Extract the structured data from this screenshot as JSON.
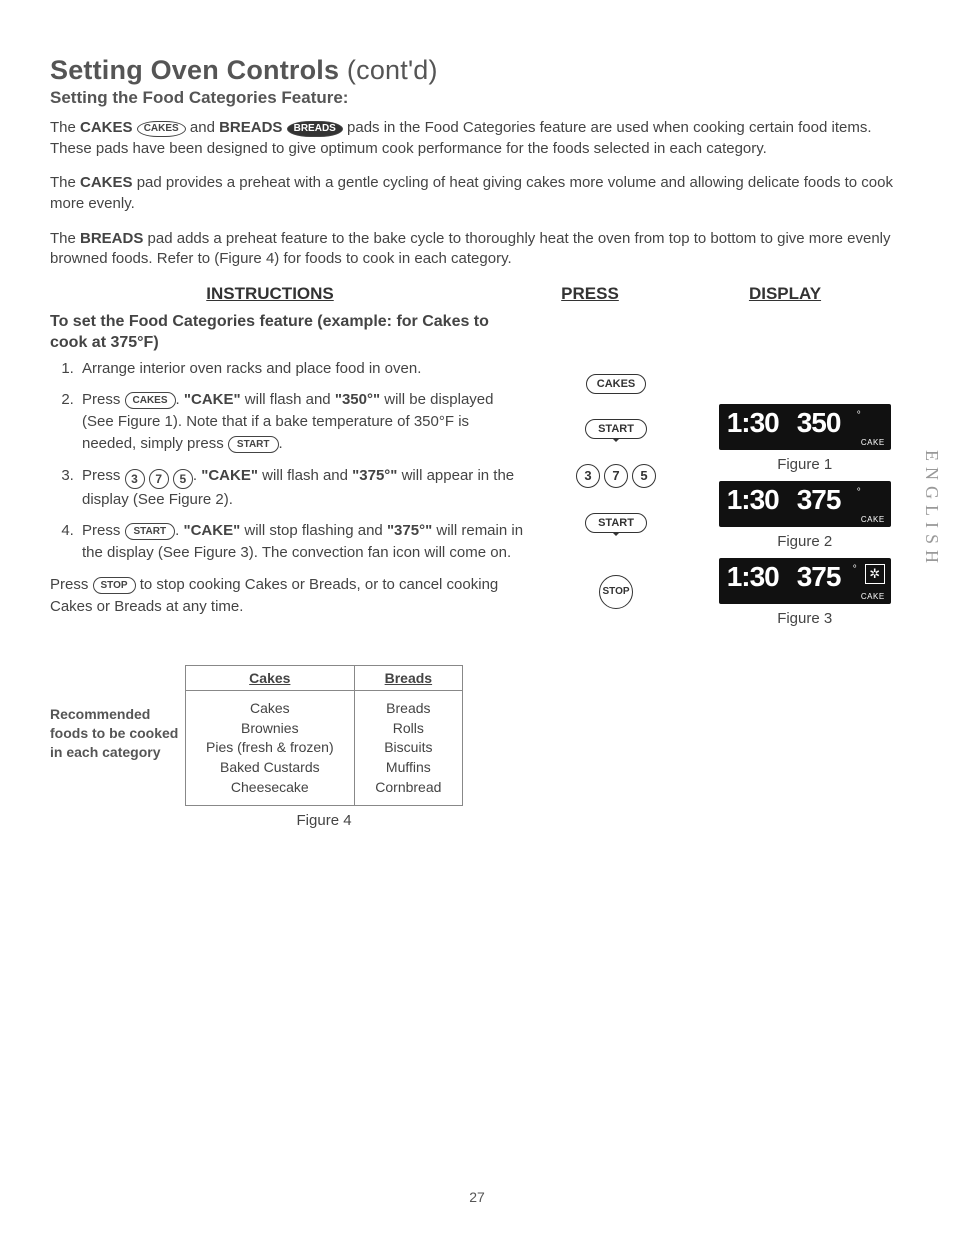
{
  "title_main": "Setting Oven Controls",
  "title_contd": "(cont'd)",
  "subhead": "Setting the Food Categories Feature:",
  "intro": {
    "p1_a": "The ",
    "p1_cakes": "CAKES",
    "p1_b": " and ",
    "p1_breads": "BREADS",
    "p1_c": " pads in the Food Categories feature are used when cooking certain food items. These pads have been designed to give optimum cook performance for the foods selected in each category.",
    "p2_a": "The ",
    "p2_b": " pad provides a preheat with a gentle cycling of heat giving cakes more volume and allowing delicate foods to cook more evenly.",
    "p3_a": "The ",
    "p3_b": " pad adds a preheat feature to the bake cycle to thoroughly heat the oven from top to bottom to give more evenly browned foods. Refer to (Figure 4) for foods to cook in each category."
  },
  "pad_cakes_label": "CAKES",
  "pad_breads_label": "BREADS",
  "col_instructions": "INSTRUCTIONS",
  "col_press": "PRESS",
  "col_display": "DISPLAY",
  "example_title": "To set the Food Categories feature (example: for Cakes to cook  at 375°F)",
  "steps": {
    "s1": "Arrange interior oven racks and place food in oven.",
    "s2_a": "Press ",
    "s2_b": ". ",
    "s2_c": "\"CAKE\"",
    "s2_d": " will flash and ",
    "s2_e": "\"350°\"",
    "s2_f": " will be displayed (See Figure 1). Note that if a bake temperature of 350°F is needed, simply press ",
    "s3_a": "Press ",
    "s3_b": ". ",
    "s3_c": "\"CAKE\"",
    "s3_d": " will flash and ",
    "s3_e": "\"375°\"",
    "s3_f": " will appear in the display (See Figure 2).",
    "s4_a": "Press ",
    "s4_b": ". ",
    "s4_c": "\"CAKE\"",
    "s4_d": " will stop flashing and ",
    "s4_e": "\"375°\"",
    "s4_f": "  will remain in the display (See Figure 3). The convection fan icon will come on."
  },
  "post_a": "Press ",
  "post_b": " to stop cooking Cakes or Breads, or to cancel cooking Cakes or Breads at any time.",
  "key_cakes": "CAKES",
  "key_start": "START",
  "key_stop": "STOP",
  "key_3": "3",
  "key_7": "7",
  "key_5": "5",
  "press": {
    "p1": "CAKES",
    "p2": "START",
    "p3a": "3",
    "p3b": "7",
    "p3c": "5",
    "p4": "START",
    "p5": "STOP"
  },
  "display": {
    "fig1_time": "1:30",
    "fig1_temp": "350",
    "fig1_mode": "CAKE",
    "fig1_cap": "Figure 1",
    "fig2_time": "1:30",
    "fig2_temp": "375",
    "fig2_mode": "CAKE",
    "fig2_cap": "Figure 2",
    "fig3_time": "1:30",
    "fig3_temp": "375",
    "fig3_mode": "CAKE",
    "fig3_fan": "✲",
    "fig3_cap": "Figure 3"
  },
  "side_english": "ENGLISH",
  "table": {
    "label": "Recommended foods to be cooked in each category",
    "h_cakes": "Cakes",
    "h_breads": "Breads",
    "cakes_items": "Cakes\nBrownies\nPies (fresh & frozen)\nBaked Custards\nCheesecake",
    "breads_items": "Breads\nRolls\nBiscuits\nMuffins\nCornbread",
    "caption": "Figure 4"
  },
  "pagenum": "27"
}
